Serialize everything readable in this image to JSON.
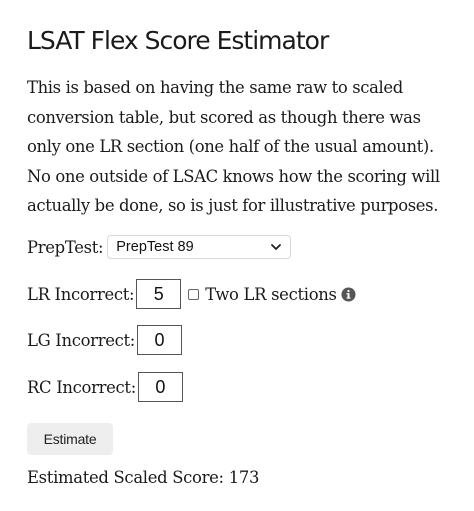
{
  "page": {
    "title": "LSAT Flex Score Estimator",
    "description": "This is based on having the same raw to scaled conversion table, but scored as though there was only one LR section (one half of the usual amount). No one outside of LSAC knows how the scoring will actually be done, so is just for illustrative purposes."
  },
  "form": {
    "preptest": {
      "label": "PrepTest:",
      "selected": "PrepTest 89"
    },
    "lr": {
      "label": "LR Incorrect:",
      "value": "5",
      "two_sections_label": "Two LR sections",
      "two_sections_checked": false
    },
    "lg": {
      "label": "LG Incorrect:",
      "value": "0"
    },
    "rc": {
      "label": "RC Incorrect:",
      "value": "0"
    },
    "estimate_button": "Estimate"
  },
  "result": {
    "label": "Estimated Scaled Score:",
    "value": "173"
  },
  "icons": {
    "dropdown": "chevron-down-icon",
    "info": "info-icon"
  },
  "colors": {
    "text": "#1a1a1a",
    "button_bg": "#eeeeee",
    "info_icon": "#555555"
  }
}
